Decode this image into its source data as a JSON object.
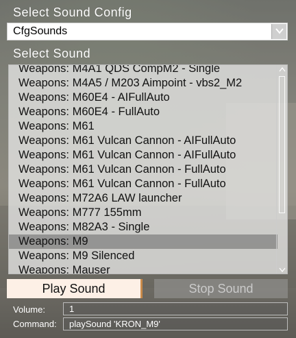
{
  "config": {
    "label": "Select Sound Config",
    "selected": "CfgSounds"
  },
  "sound": {
    "label": "Select Sound",
    "items": [
      "Weapons: M4A1 QDS CompM2 - Single",
      "Weapons: M4A5 / M203 Aimpoint - vbs2_M2",
      "Weapons: M60E4 - AIFullAuto",
      "Weapons: M60E4 - FullAuto",
      "Weapons: M61",
      "Weapons: M61 Vulcan Cannon - AIFullAuto",
      "Weapons: M61 Vulcan Cannon - AIFullAuto",
      "Weapons: M61 Vulcan Cannon - FullAuto",
      "Weapons: M61 Vulcan Cannon - FullAuto",
      "Weapons: M72A6 LAW launcher",
      "Weapons: M777 155mm",
      "Weapons: M82A3 - Single",
      "Weapons: M9",
      "Weapons: M9 Silenced",
      "Weapons: Mauser"
    ],
    "selected_index": 12
  },
  "buttons": {
    "play": "Play Sound",
    "stop": "Stop Sound"
  },
  "fields": {
    "volume_label": "Volume:",
    "volume_value": "1",
    "command_label": "Command:",
    "command_value": "playSound 'KRON_M9'"
  },
  "colors": {
    "play_bg": "#fdf0e6",
    "accent": "#c98a4a"
  }
}
